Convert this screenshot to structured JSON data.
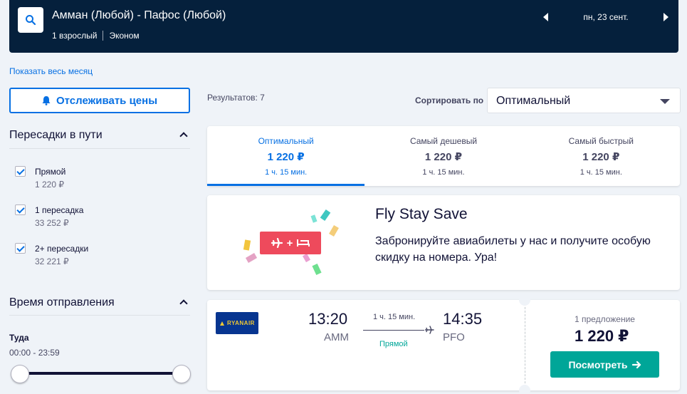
{
  "header": {
    "route": "Амман (Любой) - Пафос (Любой)",
    "passengers": "1 взрослый",
    "cabin": "Эконом",
    "date": "пн, 23 сент."
  },
  "month_link": "Показать весь месяц",
  "track_button": "Отслеживать цены",
  "filters": {
    "stops_title": "Пересадки в пути",
    "stops": [
      {
        "label": "Прямой",
        "price": "1 220 ₽",
        "checked": true
      },
      {
        "label": "1 пересадка",
        "price": "33 252 ₽",
        "checked": true
      },
      {
        "label": "2+ пересадки",
        "price": "32 221 ₽",
        "checked": true
      }
    ],
    "departure_title": "Время отправления",
    "outbound_label": "Туда",
    "outbound_range": "00:00 - 23:59",
    "outbound_start_fraction": 0.0,
    "outbound_end_fraction": 1.0
  },
  "results": {
    "count_text": "Результатов: 7",
    "sort_label": "Сортировать по",
    "sort_value": "Оптимальный"
  },
  "tabs": [
    {
      "name": "Оптимальный",
      "price": "1 220 ₽",
      "duration": "1 ч. 15 мин.",
      "active": true
    },
    {
      "name": "Самый дешевый",
      "price": "1 220 ₽",
      "duration": "1 ч. 15 мин.",
      "active": false
    },
    {
      "name": "Самый быстрый",
      "price": "1 220 ₽",
      "duration": "1 ч. 15 мин.",
      "active": false
    }
  ],
  "promo": {
    "title": "Fly Stay Save",
    "text": "Забронируйте авиабилеты у нас и получите особую скидку на номера. Ура!"
  },
  "flight": {
    "airline_logo_text": "RYANAIR",
    "depart_time": "13:20",
    "depart_airport": "AMM",
    "duration": "1 ч. 15 мин.",
    "stops": "Прямой",
    "arrive_time": "14:35",
    "arrive_airport": "PFO",
    "offers": "1 предложение",
    "price": "1 220 ₽",
    "button": "Посмотреть"
  },
  "colors": {
    "header_bg": "#05203c",
    "accent": "#0770e3",
    "cta": "#00a698",
    "promo_badge": "#ee4a5c"
  },
  "icons": [
    "search-icon",
    "chevron-left-icon",
    "chevron-right-icon",
    "bell-icon",
    "chevron-up-icon",
    "checkmark-icon",
    "caret-down-icon",
    "plane-icon",
    "bed-icon",
    "arrow-right-icon"
  ]
}
